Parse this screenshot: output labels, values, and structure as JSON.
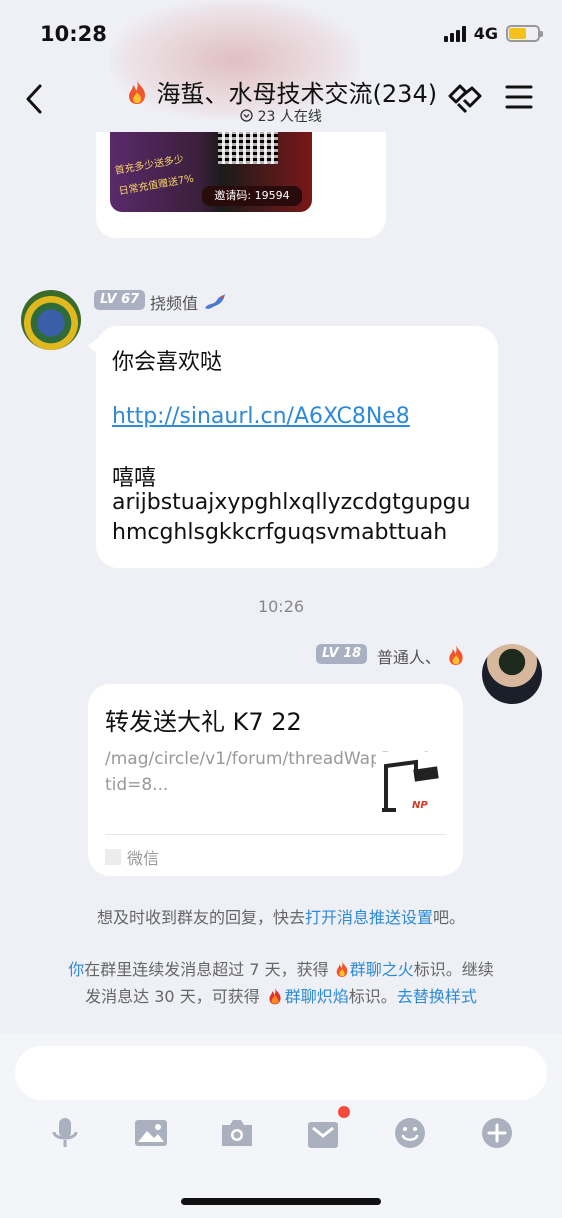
{
  "status_bar": {
    "time": "10:28",
    "network": "4G"
  },
  "header": {
    "title": "海蜇、水母技术交流(234)",
    "online": "23 人在线"
  },
  "ad_card": {
    "text1": "首充多少送多少",
    "text2": "日常充值赠送7%",
    "code": "邀请码: 19594"
  },
  "msg1": {
    "level": "LV 67",
    "nick": "挠频值",
    "line1": "你会喜欢哒",
    "link": "http://sinaurl.cn/A6XC8Ne8",
    "line3": "嘻嘻",
    "line4": "arijbstuajxypghlxqllyzcdgtgupgu",
    "line5": "hmcghlsgkkcrfguqsvmabttuah"
  },
  "timestamp": "10:26",
  "msg2": {
    "level": "LV 18",
    "nick": "普通人、",
    "card_title": "转发送大礼 K7 22",
    "card_desc": "/mag/circle/v1/forum/threadWapPage?tid=8...",
    "card_source": "微信",
    "thumb_brand": "NP"
  },
  "notice1": {
    "pre": "想及时收到群友的回复，快去",
    "link": "打开消息推送设置",
    "post": "吧。"
  },
  "notice2": {
    "you": "你",
    "a": "在群里连续发消息超过 7 天，获得 ",
    "fire1": "群聊之火",
    "b": "标识。继续",
    "c": "发消息达 30 天，可获得 ",
    "fire2": "群聊炽焰",
    "d": "标识。",
    "link": "去替换样式"
  },
  "toolbar": {
    "icons": [
      "mic-icon",
      "image-icon",
      "camera-icon",
      "gift-icon",
      "emoji-icon",
      "plus-icon"
    ]
  },
  "colors": {
    "accent": "#2e8ad6",
    "badge": "#f44c3a",
    "level": "#a9b0c2",
    "battery": "#f5c21a"
  }
}
